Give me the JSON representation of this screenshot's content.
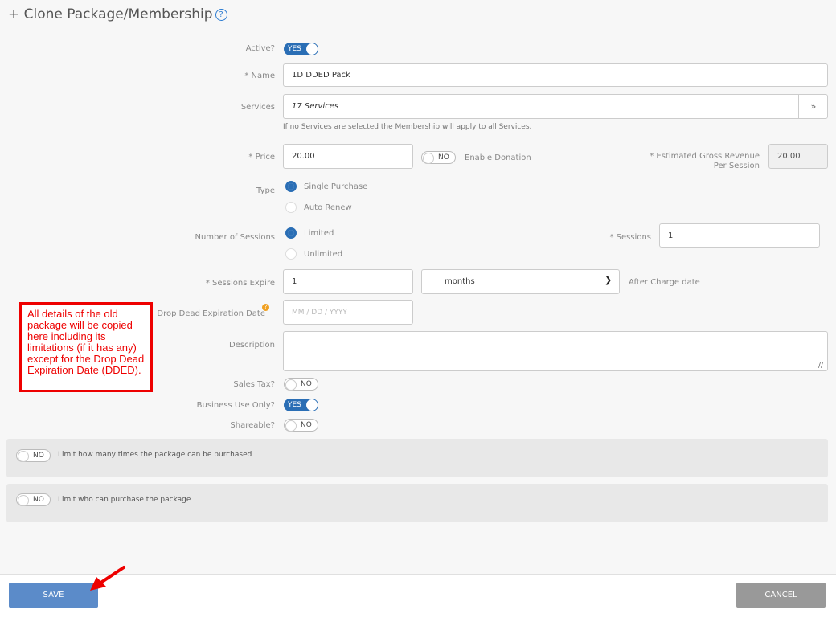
{
  "header": {
    "title": "+ Clone Package/Membership",
    "help_icon": "?"
  },
  "form": {
    "active": {
      "label": "Active?",
      "toggle": "YES"
    },
    "name": {
      "label": "* Name",
      "value": "1D DDED Pack"
    },
    "services": {
      "label": "Services",
      "value": "17 Services",
      "hint": "If no Services are selected the Membership will apply to all Services."
    },
    "price": {
      "label": "* Price",
      "value": "20.00"
    },
    "donation": {
      "toggle": "NO",
      "label": "Enable Donation"
    },
    "gross_revenue": {
      "label": "* Estimated Gross Revenue Per Session",
      "value": "20.00"
    },
    "type": {
      "label": "Type",
      "options": [
        "Single Purchase",
        "Auto Renew"
      ]
    },
    "sessions_count": {
      "label": "Number of Sessions",
      "options": [
        "Limited",
        "Unlimited"
      ]
    },
    "sessions": {
      "label": "* Sessions",
      "value": "1"
    },
    "sessions_expire": {
      "label": "* Sessions Expire",
      "value": "1",
      "unit": "months",
      "suffix": "After Charge date"
    },
    "dded": {
      "label": "Drop Dead Expiration Date",
      "placeholder": "MM / DD / YYYY"
    },
    "description": {
      "label": "Description",
      "value": ""
    },
    "sales_tax": {
      "label": "Sales Tax?",
      "toggle": "NO"
    },
    "business_use": {
      "label": "Business Use Only?",
      "toggle": "YES"
    },
    "shareable": {
      "label": "Shareable?",
      "toggle": "NO"
    }
  },
  "panels": [
    {
      "toggle": "NO",
      "label": "Limit how many times the package can be purchased"
    },
    {
      "toggle": "NO",
      "label": "Limit who can purchase the package"
    }
  ],
  "footer": {
    "save_label": "SAVE",
    "cancel_label": "CANCEL"
  },
  "annotation": {
    "text": "All details of the old package will be copied here including its limitations (if it has any) except for the Drop Dead Expiration Date (DDED)."
  },
  "colors": {
    "toggle_on": "#2a6eb5",
    "save_button": "#5b8bc9",
    "cancel_button": "#999999",
    "annotation": "#e00000"
  }
}
